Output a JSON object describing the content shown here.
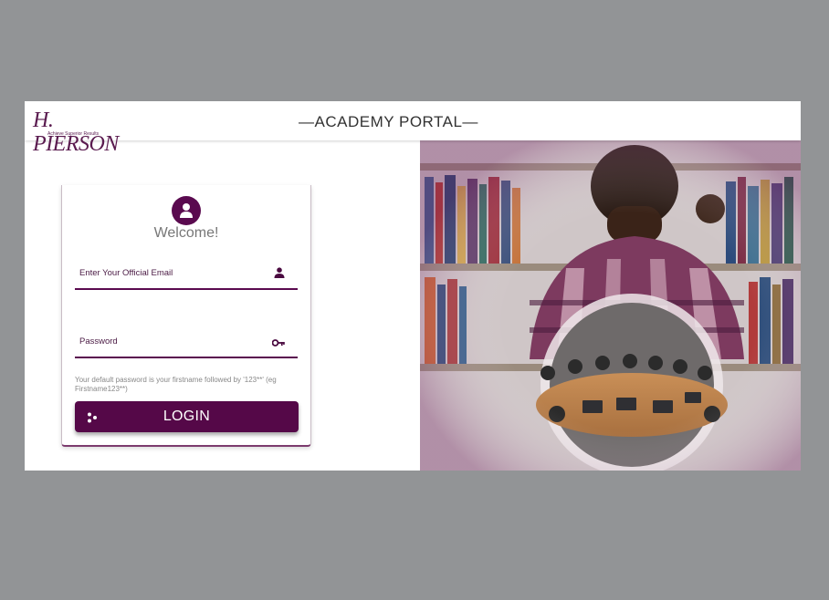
{
  "header": {
    "logo_text": "H. PIERSON",
    "logo_tagline": "Achieve Superior Results",
    "title": "—ACADEMY PORTAL—"
  },
  "login": {
    "welcome": "Welcome!",
    "email_label": "Enter Your Official Email",
    "password_label": "Password",
    "hint": "Your default password is your firstname followed by '123**' (eg Firstname123**)",
    "button_label": "LOGIN"
  },
  "icons": {
    "avatar": "user-circle-icon",
    "email": "user-icon",
    "password": "key-icon",
    "button": "dots-icon"
  },
  "colors": {
    "brand": "#550848",
    "background": "#929496"
  }
}
